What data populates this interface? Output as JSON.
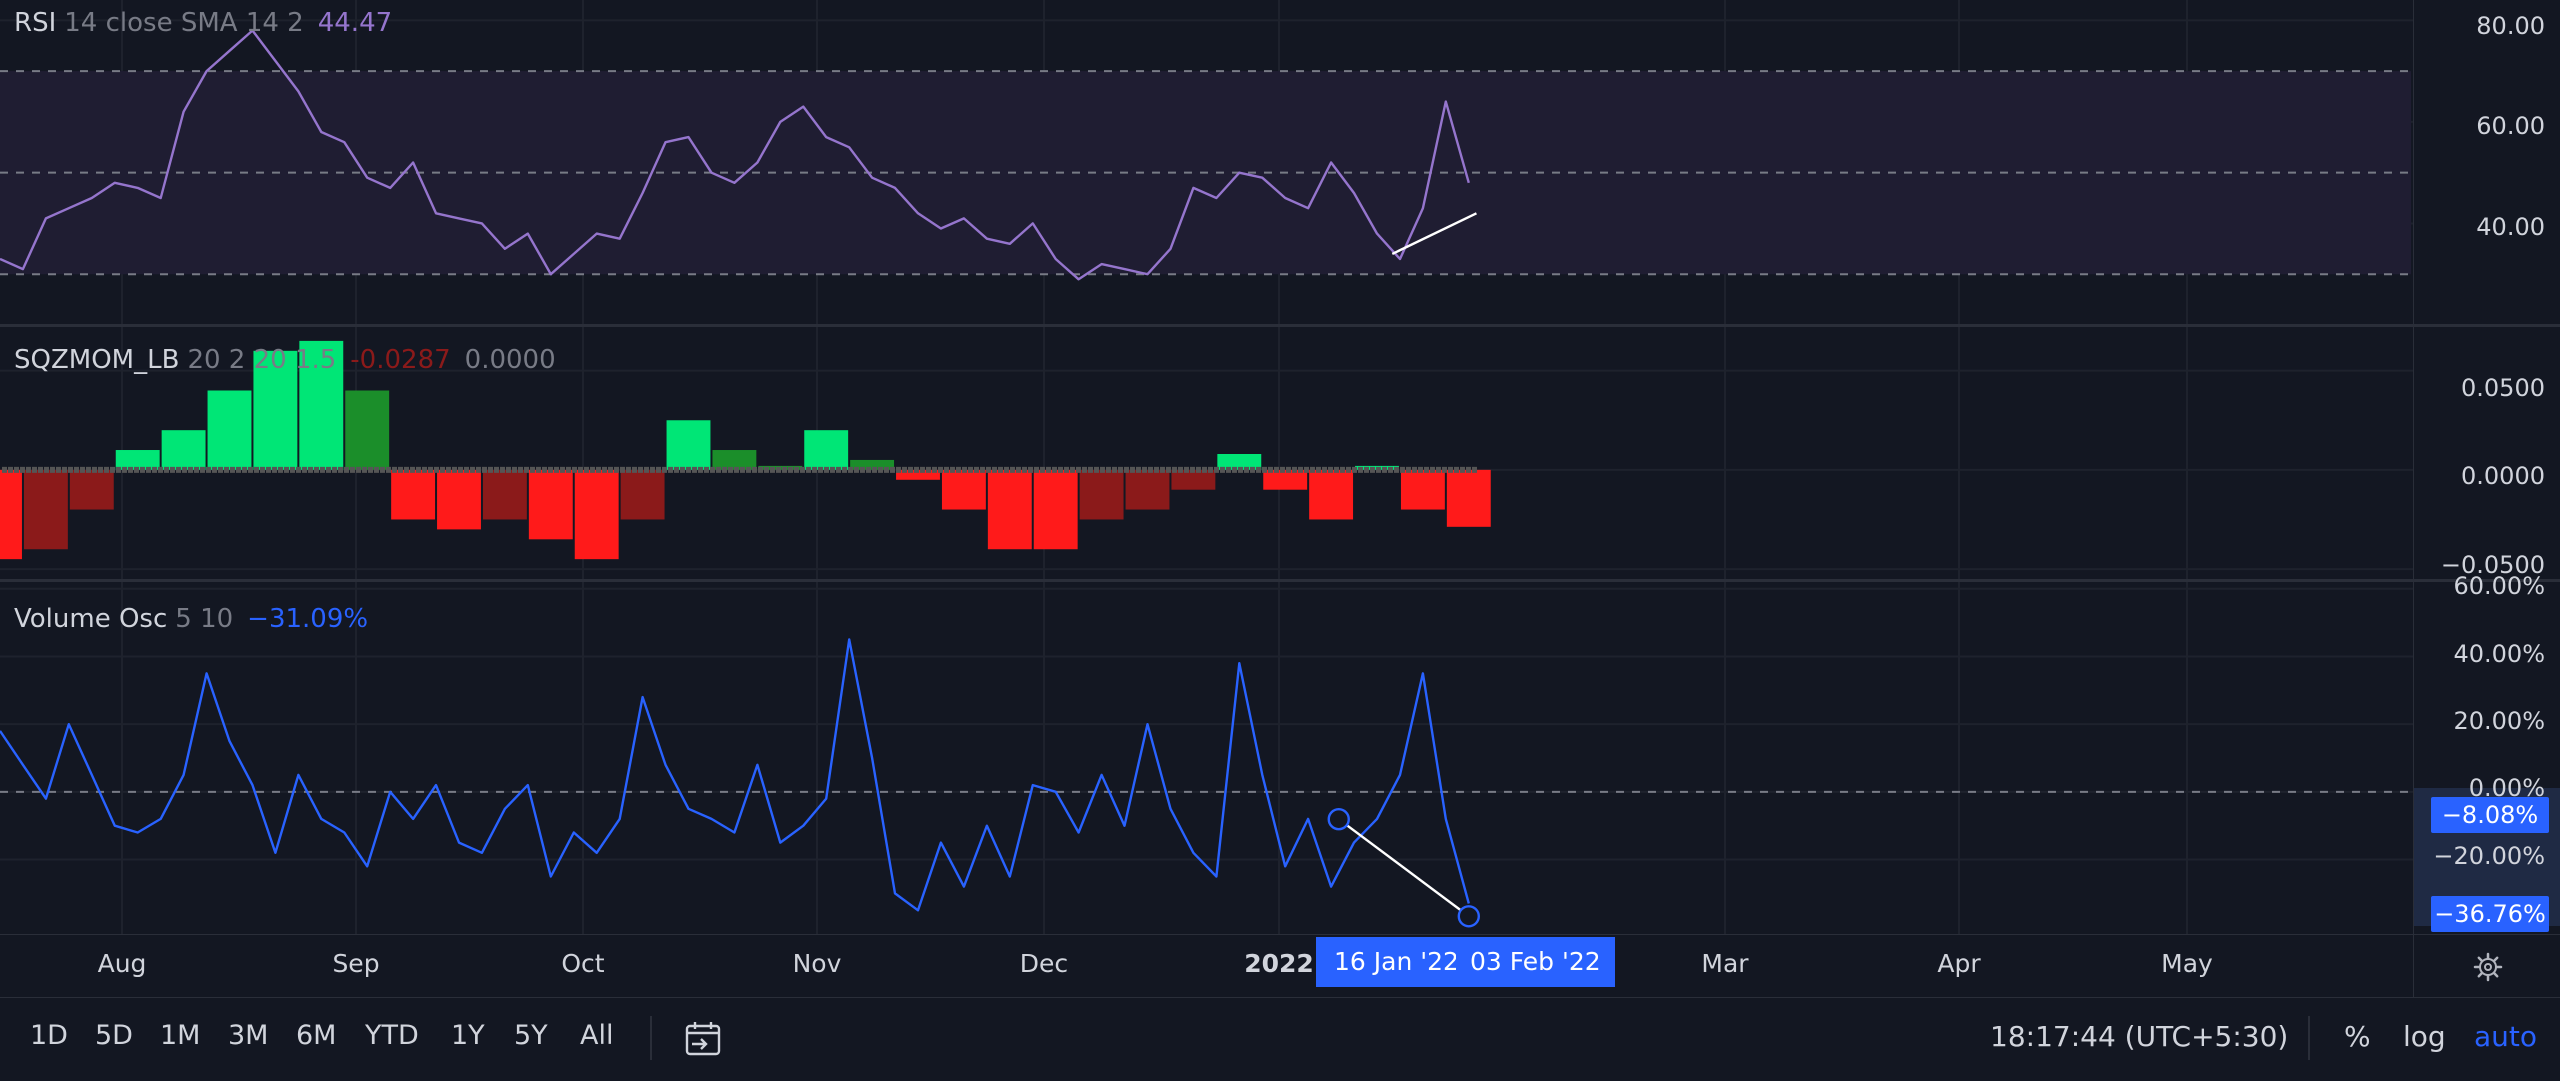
{
  "chart_data": [
    {
      "type": "line",
      "name": "rsi-pane",
      "legend": {
        "name": "RSI",
        "params": "14 close SMA 14 2",
        "value": "44.47"
      },
      "ylim": [
        20,
        84
      ],
      "y_ticks": [
        "80.00",
        "60.00",
        "40.00"
      ],
      "tick_values": [
        80,
        60,
        40
      ],
      "bands": [
        70,
        50,
        30
      ],
      "x": [
        0,
        3,
        6,
        9,
        12,
        15,
        18,
        21,
        24,
        27,
        30,
        33,
        36,
        39,
        42,
        45,
        48,
        51,
        54,
        57,
        60,
        63,
        66,
        69,
        72,
        75,
        78,
        81,
        84,
        87,
        90,
        93,
        96,
        99,
        102,
        105,
        108,
        111,
        114,
        117,
        120,
        123,
        126,
        129,
        132,
        135,
        138,
        141,
        144,
        147,
        150,
        153,
        156,
        159,
        162,
        165,
        168,
        171,
        174,
        177,
        180,
        183,
        186,
        189,
        192
      ],
      "values": [
        33,
        31,
        41,
        43,
        45,
        48,
        47,
        45,
        62,
        70,
        74,
        78,
        72,
        66,
        58,
        56,
        49,
        47,
        52,
        42,
        41,
        40,
        35,
        38,
        30,
        34,
        38,
        37,
        46,
        56,
        57,
        50,
        48,
        52,
        60,
        63,
        57,
        55,
        49,
        47,
        42,
        39,
        41,
        37,
        36,
        40,
        33,
        29,
        32,
        31,
        30,
        35,
        47,
        45,
        50,
        49,
        45,
        43,
        52,
        46,
        38,
        33,
        43,
        64,
        48
      ],
      "trendline": {
        "x": [
          182,
          193
        ],
        "values": [
          34,
          42
        ]
      },
      "colors": {
        "line": "#9575cd",
        "trend": "#ffffff",
        "band_fill": "#1f1d32"
      }
    },
    {
      "type": "bar",
      "name": "squeeze-momentum-pane",
      "legend": {
        "name": "SQZMOM_LB",
        "params": "20 2 20 1.5",
        "value1": "-0.0287",
        "value2": "0.0000"
      },
      "ylim": [
        -0.055,
        0.072
      ],
      "y_ticks": [
        "0.0500",
        "0.0000",
        "−0.0500"
      ],
      "tick_values": [
        0.05,
        0,
        -0.05
      ],
      "x": [
        0,
        6,
        12,
        18,
        24,
        30,
        36,
        42,
        48,
        54,
        60,
        66,
        72,
        78,
        84,
        90,
        96,
        102,
        108,
        114,
        120,
        126,
        132,
        138,
        144,
        150,
        156,
        162,
        168,
        174,
        180,
        186,
        192
      ],
      "values": [
        -0.045,
        -0.04,
        -0.02,
        0.01,
        0.02,
        0.04,
        0.06,
        0.065,
        0.04,
        -0.025,
        -0.03,
        -0.025,
        -0.035,
        -0.045,
        -0.025,
        0.025,
        0.01,
        0.002,
        0.02,
        0.005,
        -0.005,
        -0.02,
        -0.04,
        -0.04,
        -0.025,
        -0.02,
        -0.01,
        0.008,
        -0.01,
        -0.025,
        0.002,
        -0.02,
        -0.0287
      ],
      "colors": {
        "pos_up": "#00e676",
        "pos_down": "#1b8e2a",
        "neg_down": "#ff1a1a",
        "neg_up": "#8b1a1a",
        "dot": "#555555"
      }
    },
    {
      "type": "line",
      "name": "volume-oscillator-pane",
      "legend": {
        "name": "Volume Osc",
        "params": "5 10",
        "value": "−31.09%"
      },
      "ylim": [
        -42,
        62
      ],
      "y_ticks": [
        "60.00%",
        "40.00%",
        "20.00%",
        "0.00%",
        "−20.00%"
      ],
      "tick_values": [
        60,
        40,
        20,
        0,
        -20
      ],
      "zero_line": 0,
      "x": [
        0,
        3,
        6,
        9,
        12,
        15,
        18,
        21,
        24,
        27,
        30,
        33,
        36,
        39,
        42,
        45,
        48,
        51,
        54,
        57,
        60,
        63,
        66,
        69,
        72,
        75,
        78,
        81,
        84,
        87,
        90,
        93,
        96,
        99,
        102,
        105,
        108,
        111,
        114,
        117,
        120,
        123,
        126,
        129,
        132,
        135,
        138,
        141,
        144,
        147,
        150,
        153,
        156,
        159,
        162,
        165,
        168,
        171,
        174,
        177,
        180,
        183,
        186,
        189,
        192
      ],
      "values": [
        18,
        8,
        -2,
        20,
        5,
        -10,
        -12,
        -8,
        5,
        35,
        15,
        2,
        -18,
        5,
        -8,
        -12,
        -22,
        0,
        -8,
        2,
        -15,
        -18,
        -5,
        2,
        -25,
        -12,
        -18,
        -8,
        28,
        8,
        -5,
        -8,
        -12,
        8,
        -15,
        -10,
        -2,
        45,
        10,
        -30,
        -35,
        -15,
        -28,
        -10,
        -25,
        2,
        0,
        -12,
        5,
        -10,
        20,
        -5,
        -18,
        -25,
        38,
        5,
        -22,
        -8,
        -28,
        -15,
        -8,
        5,
        35,
        -8,
        -33
      ],
      "divergence": {
        "x": [
          175,
          192
        ],
        "values": [
          -8.08,
          -36.76
        ]
      },
      "colors": {
        "line": "#2962ff",
        "trend": "#ffffff",
        "badge": "#2962ff"
      }
    }
  ],
  "price_badges": [
    "−8.08%",
    "−36.76%"
  ],
  "time_axis": {
    "months": [
      "Aug",
      "Sep",
      "Oct",
      "Nov",
      "Dec",
      "2022",
      "Mar",
      "Apr",
      "May"
    ],
    "date_badges": [
      "16 Jan '22",
      "03 Feb '22"
    ]
  },
  "bottom_bar": {
    "ranges": [
      "1D",
      "5D",
      "1M",
      "3M",
      "6M",
      "YTD",
      "1Y",
      "5Y",
      "All"
    ],
    "goto_icon": "calendar-goto-icon",
    "clock": "18:17:44 (UTC+5:30)",
    "percent": "%",
    "log": "log",
    "auto": "auto"
  },
  "settings_icon": "gear-icon"
}
